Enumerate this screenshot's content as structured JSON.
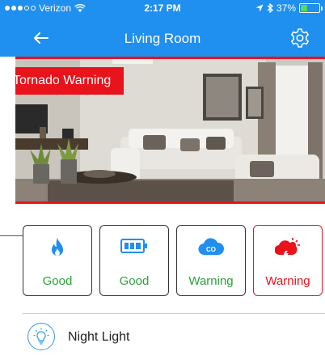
{
  "status_bar": {
    "carrier": "Verizon",
    "signal_bars_filled": 3,
    "signal_bars_total": 5,
    "wifi_icon": "wifi-icon",
    "time": "2:17 PM",
    "location_icon": "location-arrow-icon",
    "bluetooth_icon": "bluetooth-icon",
    "battery_percent": "37%",
    "battery_level": 0.37
  },
  "nav": {
    "back_icon": "arrow-left-icon",
    "title": "Living Room",
    "settings_icon": "gear-icon"
  },
  "camera": {
    "alert_banner": "Tornado Warning"
  },
  "sensors": [
    {
      "icon": "flame-icon",
      "status": "Good"
    },
    {
      "icon": "battery-icon",
      "status": "Good"
    },
    {
      "icon": "co-cloud-icon",
      "status": "Warning"
    },
    {
      "icon": "storm-cloud-icon",
      "status": "Warning"
    }
  ],
  "devices": [
    {
      "icon": "lightbulb-icon",
      "label": "Night Light"
    }
  ],
  "colors": {
    "header_blue": "#1f8ff0",
    "alert_red": "#e8131b",
    "good_green": "#2aa13a",
    "icon_blue": "#1f8ff0"
  }
}
